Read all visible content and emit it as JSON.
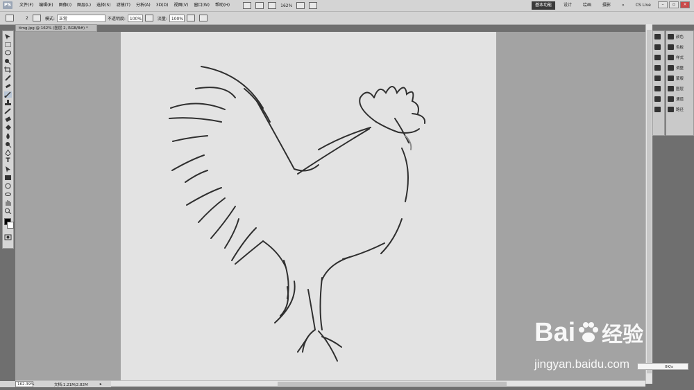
{
  "app": {
    "logo": "PS"
  },
  "menubar": {
    "items": [
      "文件(F)",
      "编辑(E)",
      "图像(I)",
      "图层(L)",
      "选择(S)",
      "滤镜(T)",
      "分析(A)",
      "3D(D)",
      "视图(V)",
      "窗口(W)",
      "帮助(H)"
    ],
    "zoom": "162%",
    "workspace_active": "基本功能",
    "workspaces": [
      "设计",
      "绘画",
      "摄影"
    ],
    "cs_live": "CS Live"
  },
  "options": {
    "brush_size": "2",
    "mode_label": "模式:",
    "mode_value": "正常",
    "opacity_label": "不透明度:",
    "opacity_value": "100%",
    "flow_label": "流量:",
    "flow_value": "100%"
  },
  "document": {
    "tab_title": "timg.jpg @ 162% (图层 2, RGB/8#) *"
  },
  "statusbar": {
    "zoom": "162.39%",
    "doc_info": "文档:1.21M/2.82M"
  },
  "panels": {
    "labels": [
      "颜色",
      "色板",
      "样式",
      "调整",
      "蒙版",
      "图层",
      "通道",
      "路径"
    ]
  },
  "watermark": {
    "brand": "Bai",
    "brand_cn": "经验",
    "url": "jingyan.baidu.com"
  },
  "speed_widget": {
    "value": "0K/s"
  },
  "colors": {
    "chrome": "#d4d4d4",
    "canvas_bg": "#e3e3e3",
    "pasteboard": "#a3a3a3",
    "stroke": "#2f2f2f"
  },
  "icons": [
    "brush-icon",
    "move-icon",
    "marquee-icon",
    "lasso-icon",
    "crop-icon",
    "eyedropper-icon",
    "heal-icon",
    "brush-tool-icon",
    "stamp-icon",
    "eraser-icon",
    "bucket-icon",
    "dodge-icon",
    "pen-icon",
    "type-icon",
    "path-select-icon",
    "shape-icon",
    "hand-icon",
    "zoom-icon"
  ]
}
